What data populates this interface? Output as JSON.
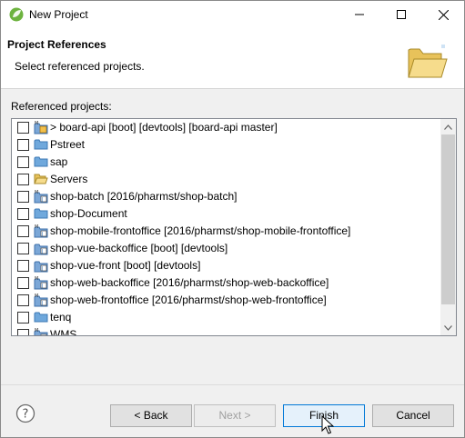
{
  "window": {
    "title": "New Project"
  },
  "banner": {
    "title": "Project References",
    "description": "Select referenced projects."
  },
  "section": {
    "label": "Referenced projects:"
  },
  "projects": [
    {
      "label": "> board-api [boot] [devtools] [board-api master]",
      "icon": "maven-git-project-icon"
    },
    {
      "label": "Pstreet",
      "icon": "folder-icon"
    },
    {
      "label": "sap",
      "icon": "folder-icon"
    },
    {
      "label": "Servers",
      "icon": "open-folder-icon"
    },
    {
      "label": "shop-batch [2016/pharmst/shop-batch]",
      "icon": "maven-project-icon"
    },
    {
      "label": "shop-Document",
      "icon": "folder-icon"
    },
    {
      "label": "shop-mobile-frontoffice [2016/pharmst/shop-mobile-frontoffice]",
      "icon": "maven-project-icon"
    },
    {
      "label": "shop-vue-backoffice [boot] [devtools]",
      "icon": "java-project-icon"
    },
    {
      "label": "shop-vue-front [boot] [devtools]",
      "icon": "java-project-icon"
    },
    {
      "label": "shop-web-backoffice [2016/pharmst/shop-web-backoffice]",
      "icon": "maven-project-icon"
    },
    {
      "label": "shop-web-frontoffice [2016/pharmst/shop-web-frontoffice]",
      "icon": "maven-project-icon"
    },
    {
      "label": "tenq",
      "icon": "folder-icon"
    },
    {
      "label": "WMS",
      "icon": "maven-project-icon"
    }
  ],
  "buttons": {
    "back": "< Back",
    "next": "Next >",
    "finish": "Finish",
    "cancel": "Cancel"
  }
}
